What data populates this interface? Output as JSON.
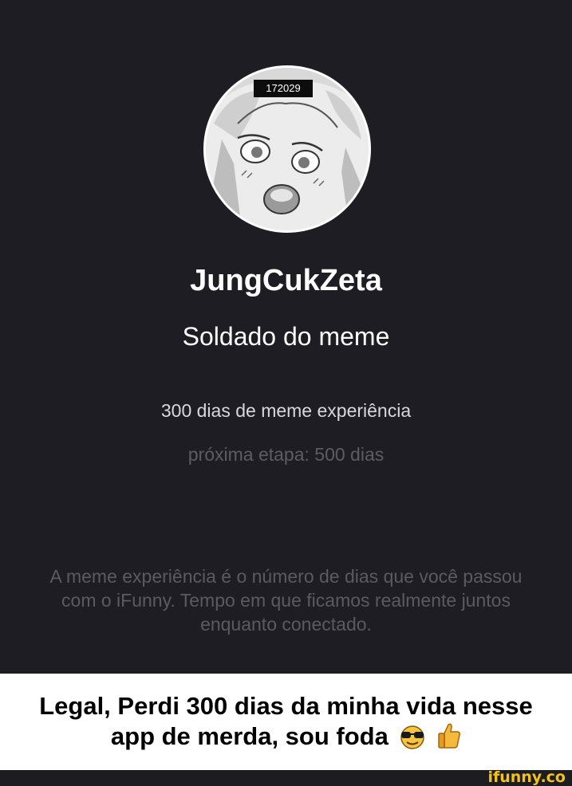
{
  "profile": {
    "avatar_id": "172029",
    "username": "JungCukZeta",
    "rank": "Soldado do meme",
    "experience": "300 dias de meme experiência",
    "next_stage": "próxima etapa: 500 dias",
    "explanation": "A meme experiência é o número de dias que você passou com o iFunny. Tempo em que ficamos realmente juntos enquanto conectado."
  },
  "caption": {
    "line1": "Legal, Perdi 300 dias da minha vida nesse",
    "line2": "app de merda, sou foda",
    "emojis": [
      "sunglasses-face-emoji",
      "thumbs-up-emoji"
    ]
  },
  "watermark": {
    "text": "ifunny.co"
  },
  "colors": {
    "background": "#1d1d23",
    "text_primary": "#ffffff",
    "text_muted": "#5c5c62",
    "watermark": "#f2c21a"
  }
}
